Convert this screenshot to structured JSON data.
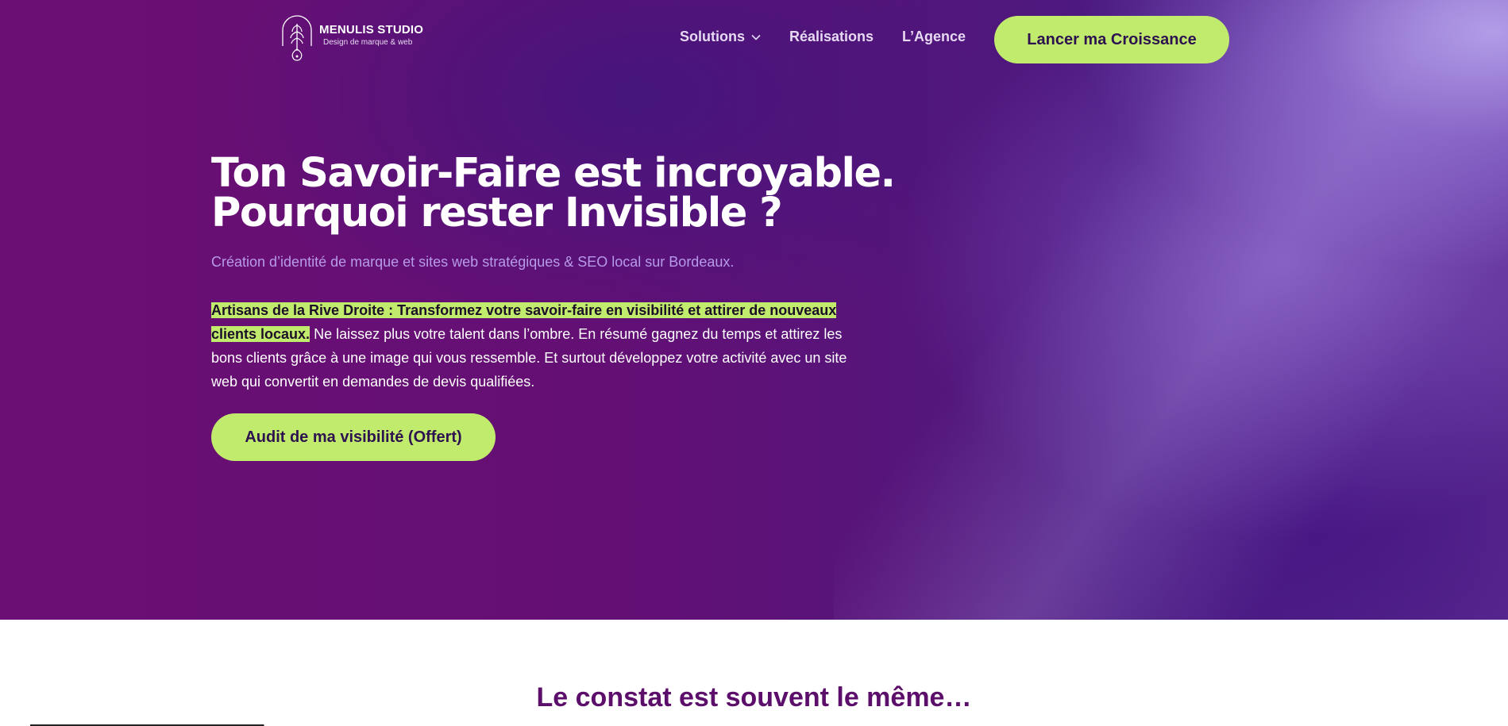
{
  "brand": {
    "name": "MENULIS STUDIO",
    "tagline": "Design de marque & web"
  },
  "nav": {
    "items": [
      {
        "label": "Solutions",
        "has_dropdown": true
      },
      {
        "label": "Réalisations"
      },
      {
        "label": "L’Agence"
      }
    ],
    "cta_label": "Lancer ma Croissance"
  },
  "hero": {
    "headline_line1": "Ton Savoir-Faire est incroyable.",
    "headline_line2": "Pourquoi rester Invisible ?",
    "subtitle": "Création d’identité de marque et sites web stratégiques & SEO local sur Bordeaux.",
    "highlight_text": "Artisans de la Rive Droite : Transformez votre savoir-faire en visibilité et attirer de nouveaux clients locaux.",
    "body_text": " Ne laissez plus votre talent dans l’ombre. En résumé gagnez du temps et attirez les bons clients grâce à une image qui vous ressemble. Et surtout développez votre activité avec un site web qui convertit en demandes de devis qualifiées.",
    "cta_label": "Audit de ma visibilité (Offert)"
  },
  "next_section": {
    "title": "Le constat est souvent le même…"
  },
  "colors": {
    "accent": "#c1eb6c",
    "hero_purple": "#6b0f74",
    "section_title": "#5c0e6b",
    "subtitle": "#b79be8"
  },
  "icons": {
    "logo": "leaf-drop-logo-icon",
    "dropdown": "chevron-down-icon"
  }
}
